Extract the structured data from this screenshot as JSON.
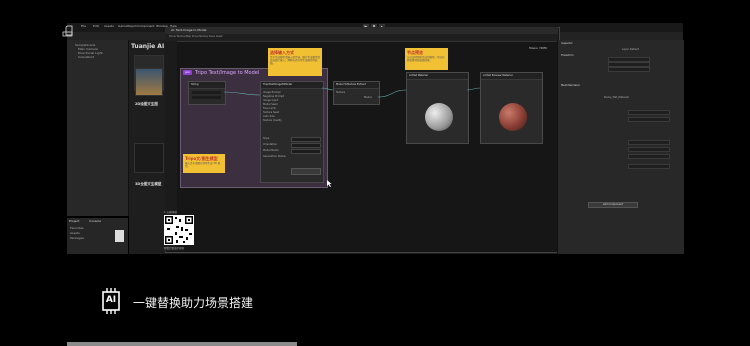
{
  "editor": {
    "menu": [
      "File",
      "Edit",
      "Assets",
      "GameObject",
      "Component",
      "Window",
      "Help"
    ],
    "graph_tab": "AI: Text-Image to Model",
    "graph_toolbar": "Show TextureMap   Show Names   Save Asset",
    "hierarchy_items": [
      "SampleScene",
      "Main Camera",
      "Directional Light",
      "SceneRoot"
    ],
    "project_label": "Project",
    "console_label": "Console",
    "project_items": [
      "Favorites",
      "Assets",
      "Packages"
    ],
    "scene_title": "Tuanjie AI G",
    "card_labels": [
      "2D绘图文生图",
      "3D全图文生模型"
    ],
    "tokens_label": "Tokens: 74855"
  },
  "graph": {
    "badge": "pix",
    "group_title": "Tripo Text/Image to Model",
    "text_node_title": "String",
    "tripo_node_title": "TripoTextImageToModel",
    "tripo_rows": [
      "Image Prompt",
      "Negative Prompt",
      "Image Input",
      "Model Seed",
      "Face Limit",
      "Texture Seed",
      "Auto Size",
      "Texture Quality",
      "Style",
      "Orientation",
      "Model Name",
      "Generation Status"
    ],
    "mid_node_title": "Model ToTexture Extract",
    "mid_rows": [
      "Texture",
      "Normal Albedo",
      "Model",
      "Normals"
    ],
    "mat_node_1": "AI Mat Material",
    "mat_node_2": "AI Mat Preview Material",
    "sticky_1": {
      "title": "选择输入方式",
      "body": "文字生成模型请输入提示词，图片生成模型请连接图片输入；两种方式均可生成模型并贴图。"
    },
    "sticky_2": {
      "title": "节点预览",
      "body": "节点实时预览生成的模型，可在右侧查看材质贴图效果。"
    },
    "sticky_3": {
      "title": "Tripo文/图生模型",
      "body": "输入文字或图片即可生成 3D 模型。"
    }
  },
  "inspector": {
    "header": "Inspector",
    "layer_label": "Layer  Default",
    "section_1": "Transform",
    "section_2": "Mesh Renderer",
    "section_3": "Rocky_Mat_Material",
    "add_component": "Add Component"
  },
  "qr": {
    "caption_top": "1. 扫码体验",
    "caption_bottom": "观看完整演示视频"
  },
  "caption": {
    "icon_text": "AI",
    "text": "一键替换助力场景搭建"
  },
  "colors": {
    "accent_purple": "#8f3fd1",
    "sticky_yellow": "#f2c033",
    "group_bg": "#3b2f40"
  }
}
